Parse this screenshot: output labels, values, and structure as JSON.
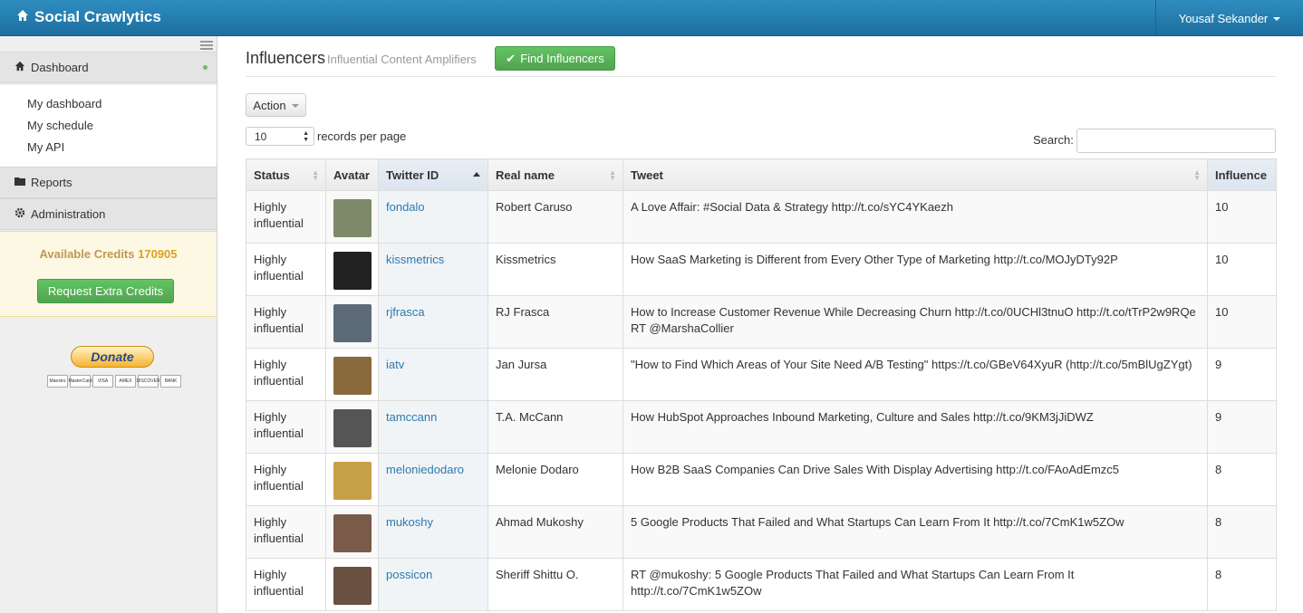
{
  "navbar": {
    "brand": "Social Crawlytics",
    "user": "Yousaf Sekander"
  },
  "sidebar": {
    "dashboard": "Dashboard",
    "sub_items": [
      "My dashboard",
      "My schedule",
      "My API"
    ],
    "reports": "Reports",
    "administration": "Administration",
    "credits_label": "Available Credits",
    "credits_value": "170905",
    "request_button": "Request Extra Credits",
    "donate": "Donate",
    "cards": [
      "Maestro",
      "MasterCard",
      "VISA",
      "AMEX",
      "DISCOVER",
      "BANK"
    ]
  },
  "main": {
    "title": "Influencers",
    "subtitle": "Influential Content Amplifiers",
    "find_button": "Find Influencers",
    "action_button": "Action",
    "page_size": "10",
    "records_per_page": "records per page",
    "search_label": "Search:",
    "columns": [
      "Status",
      "Avatar",
      "Twitter ID",
      "Real name",
      "Tweet",
      "Influence"
    ],
    "rows": [
      {
        "status": "Highly influential",
        "twitter": "fondalo",
        "name": "Robert Caruso",
        "tweet": "A Love Affair: #Social Data & Strategy http://t.co/sYC4YKaezh",
        "influence": "10",
        "avatar_color": "#7d8a6a"
      },
      {
        "status": "Highly influential",
        "twitter": "kissmetrics",
        "name": "Kissmetrics",
        "tweet": "How SaaS Marketing is Different from Every Other Type of Marketing http://t.co/MOJyDTy92P",
        "influence": "10",
        "avatar_color": "#222222"
      },
      {
        "status": "Highly influential",
        "twitter": "rjfrasca",
        "name": "RJ Frasca",
        "tweet": "How to Increase Customer Revenue While Decreasing Churn http://t.co/0UCHl3tnuO http://t.co/tTrP2w9RQe RT @MarshaCollier",
        "influence": "10",
        "avatar_color": "#5c6a78"
      },
      {
        "status": "Highly influential",
        "twitter": "iatv",
        "name": "Jan Jursa",
        "tweet": "\"How to Find Which Areas of Your Site Need A/B Testing\" https://t.co/GBeV64XyuR (http://t.co/5mBlUgZYgt)",
        "influence": "9",
        "avatar_color": "#8a6a3c"
      },
      {
        "status": "Highly influential",
        "twitter": "tamccann",
        "name": "T.A. McCann",
        "tweet": "How HubSpot Approaches Inbound Marketing, Culture and Sales http://t.co/9KM3jJiDWZ",
        "influence": "9",
        "avatar_color": "#555555"
      },
      {
        "status": "Highly influential",
        "twitter": "meloniedodaro",
        "name": "Melonie Dodaro",
        "tweet": "How B2B SaaS Companies Can Drive Sales With Display Advertising http://t.co/FAoAdEmzc5",
        "influence": "8",
        "avatar_color": "#c7a04a"
      },
      {
        "status": "Highly influential",
        "twitter": "mukoshy",
        "name": "Ahmad Mukoshy",
        "tweet": "5 Google Products That Failed and What Startups Can Learn From It http://t.co/7CmK1w5ZOw",
        "influence": "8",
        "avatar_color": "#7a5a48"
      },
      {
        "status": "Highly influential",
        "twitter": "possicon",
        "name": "Sheriff Shittu O.",
        "tweet": "RT @mukoshy: 5 Google Products That Failed and What Startups Can Learn From It http://t.co/7CmK1w5ZOw",
        "influence": "8",
        "avatar_color": "#6a5040"
      }
    ]
  }
}
